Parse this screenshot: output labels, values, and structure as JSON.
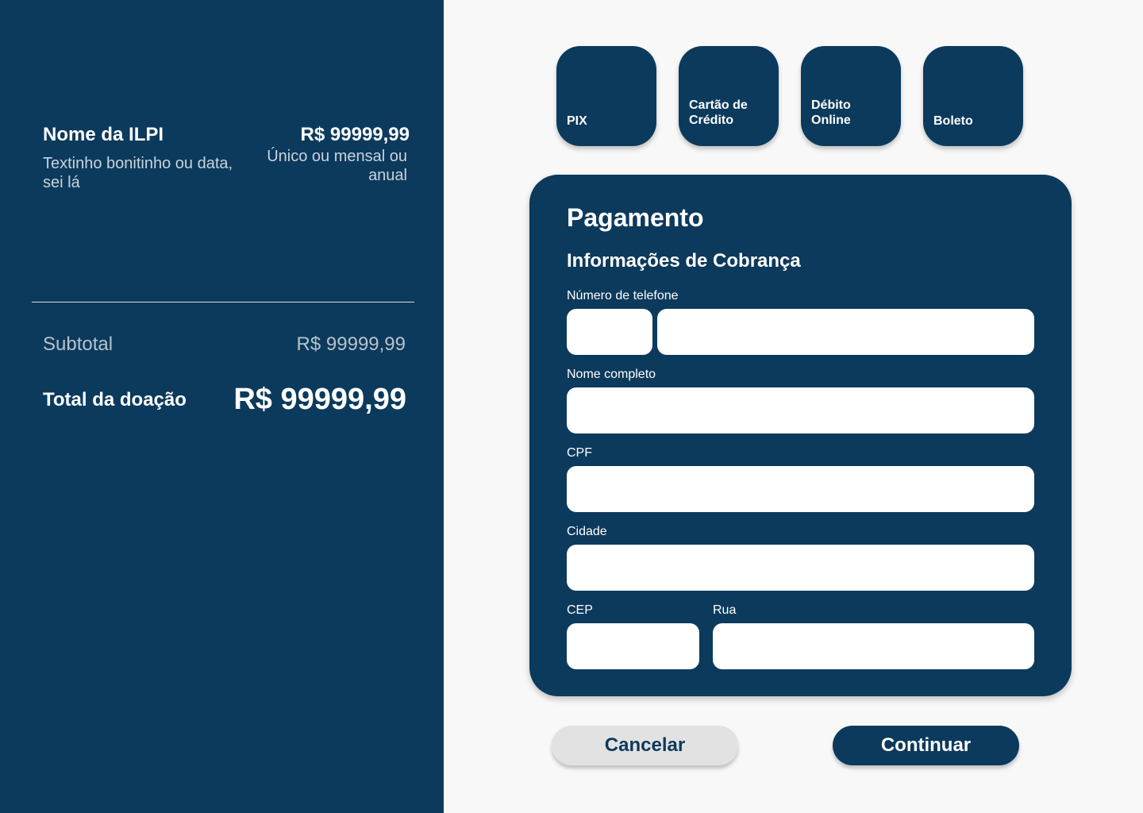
{
  "summary": {
    "ilpi_name": "Nome da ILPI",
    "ilpi_description": "Textinho  bonitinho ou data, sei lá",
    "price": "R$ 99999,99",
    "frequency": "Único ou mensal ou anual",
    "subtotal_label": "Subtotal",
    "subtotal_value": "R$ 99999,99",
    "total_label": "Total da doação",
    "total_value": "R$ 99999,99"
  },
  "payment_methods": [
    {
      "line1": "PIX",
      "line2": ""
    },
    {
      "line1": "Cartão de",
      "line2": "Crédito"
    },
    {
      "line1": "Débito",
      "line2": "Online"
    },
    {
      "line1": "Boleto",
      "line2": ""
    }
  ],
  "form": {
    "title": "Pagamento",
    "subtitle": "Informações de Cobrança",
    "phone_label": "Número de telefone",
    "phone_ddd_value": "",
    "phone_number_value": "",
    "name_label": "Nome completo",
    "name_value": "",
    "cpf_label": "CPF",
    "cpf_value": "",
    "city_label": "Cidade",
    "city_value": "",
    "cep_label": "CEP",
    "cep_value": "",
    "street_label": "Rua",
    "street_value": ""
  },
  "actions": {
    "cancel_label": "Cancelar",
    "continue_label": "Continuar"
  },
  "colors": {
    "primary": "#0c3a5c",
    "background": "#f8f8f8",
    "cancel_bg": "#e2e2e2"
  }
}
